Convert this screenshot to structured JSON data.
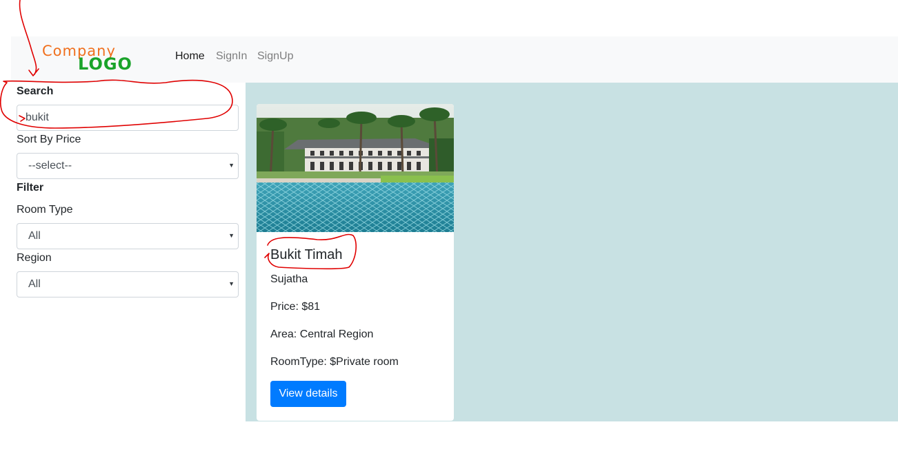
{
  "navbar": {
    "logo": {
      "line1": "Company",
      "line2": "LOGO"
    },
    "links": [
      "Home",
      "SignIn",
      "SignUp"
    ]
  },
  "sidebar": {
    "search_label": "Search",
    "search_value": "bukit",
    "sort_label": "Sort By Price",
    "sort_value": "--select--",
    "filter_label": "Filter",
    "room_type_label": "Room Type",
    "room_type_value": "All",
    "region_label": "Region",
    "region_value": "All"
  },
  "listing": {
    "title": "Bukit Timah",
    "host": "Sujatha",
    "price": "Price: $81",
    "area": "Area: Central Region",
    "room_type": "RoomType: $Private room",
    "button": "View details"
  },
  "colors": {
    "primary": "#007bff",
    "content_bg": "#c8e1e3",
    "annotation": "#e00000"
  }
}
